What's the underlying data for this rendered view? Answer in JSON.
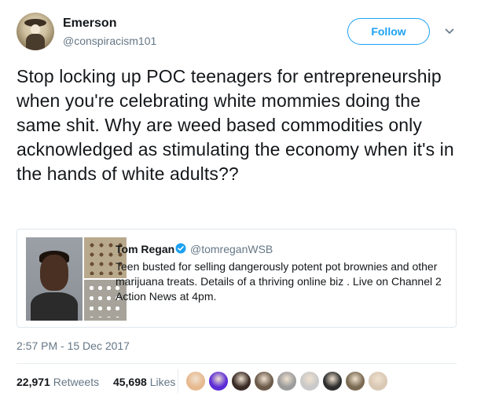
{
  "author": {
    "name": "Emerson",
    "handle": "@conspiracism101"
  },
  "follow_label": "Follow",
  "tweet_text": "Stop locking up POC teenagers for entrepreneurship when you're celebrating white mommies doing the same shit. Why are weed based commodities only acknowledged as stimulating the economy when it's in the hands of white adults??",
  "quoted": {
    "name": "Tom Regan",
    "handle": "@tomreganWSB",
    "text": "Teen busted for selling dangerously potent pot brownies and other marijuana treats. Details of a thriving online biz . Live on Channel 2 Action News at 4pm."
  },
  "timestamp": "2:57 PM - 15 Dec 2017",
  "stats": {
    "retweets_count": "22,971",
    "retweets_label": "Retweets",
    "likes_count": "45,698",
    "likes_label": "Likes"
  },
  "icons": {
    "chevron": "chevron-down-icon",
    "verified": "verified-badge-icon"
  },
  "colors": {
    "accent": "#1da1f2",
    "secondary_text": "#657786",
    "primary_text": "#14171a",
    "liker_avatars": [
      "#e7b98f",
      "#5b2bd6",
      "#3a2a25",
      "#6b5a4a",
      "#9b9b9b",
      "#c9c9c9",
      "#2e2e2e",
      "#7a6a52",
      "#d9c8b4"
    ]
  }
}
